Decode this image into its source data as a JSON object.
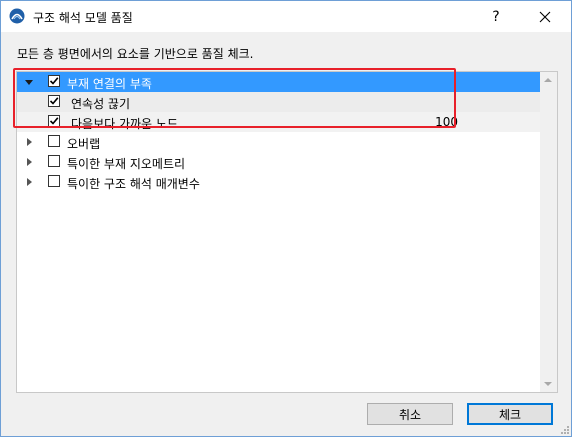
{
  "window": {
    "title": "구조 해석 모델 품질",
    "help_label": "?",
    "close_label": "✕"
  },
  "description": "모든 층 평면에서의 요소를 기반으로 품질 체크.",
  "tree": {
    "items": [
      {
        "label": "부재 연결의 부족",
        "checked": true,
        "expanded": true,
        "selected": true,
        "value": ""
      },
      {
        "label": "연속성 끊기",
        "checked": true,
        "child": true,
        "value": ""
      },
      {
        "label": "다음보다 가까운 노드",
        "checked": true,
        "child": true,
        "value": "100"
      },
      {
        "label": "오버랩",
        "checked": false,
        "expanded": false,
        "value": ""
      },
      {
        "label": "특이한 부재 지오메트리",
        "checked": false,
        "expanded": false,
        "value": ""
      },
      {
        "label": "특이한 구조 해석 매개변수",
        "checked": false,
        "expanded": false,
        "value": ""
      }
    ]
  },
  "buttons": {
    "cancel": "취소",
    "check": "체크"
  },
  "colors": {
    "selection": "#3399ff",
    "highlight_box": "#e8202a",
    "primary_border": "#0078d7"
  }
}
